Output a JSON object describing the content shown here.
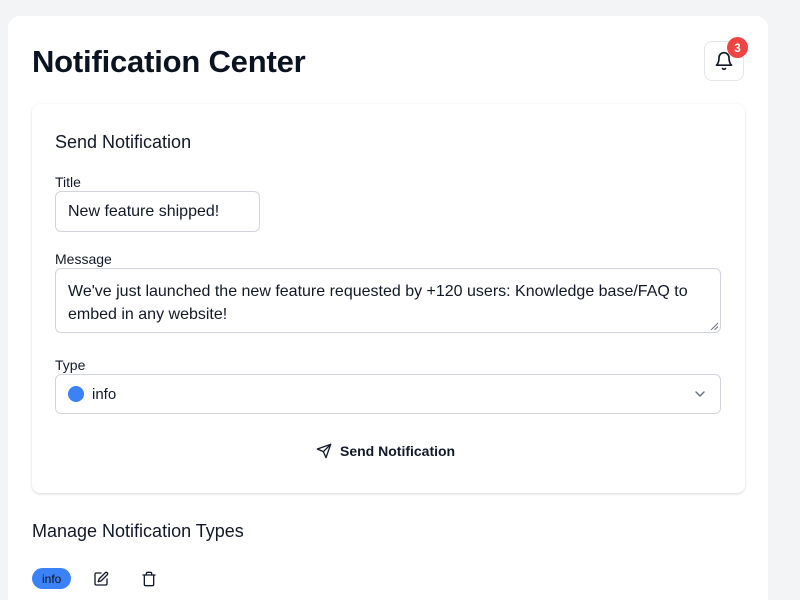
{
  "header": {
    "title": "Notification Center",
    "badge_count": "3"
  },
  "send_form": {
    "title": "Send Notification",
    "title_label": "Title",
    "title_value": "New feature shipped!",
    "message_label": "Message",
    "message_value": "We've just launched the new feature requested by +120 users: Knowledge base/FAQ to embed in any website!",
    "type_label": "Type",
    "type_value": "info",
    "type_color": "#3b82f6",
    "send_label": "Send Notification"
  },
  "manage": {
    "title": "Manage Notification Types",
    "types": [
      {
        "label": "info",
        "color": "#3b82f6"
      }
    ]
  },
  "icons": {
    "bell": "bell-icon",
    "send": "send-icon",
    "chevron": "chevron-down-icon",
    "edit": "edit-icon",
    "delete": "trash-icon"
  }
}
